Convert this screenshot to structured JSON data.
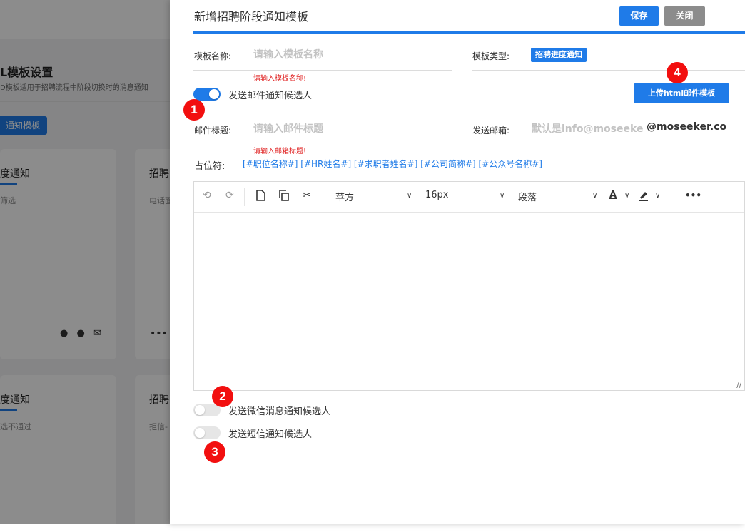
{
  "background": {
    "page_title": "L模板设置",
    "page_desc": "D模板适用于招聘流程中阶段切换时的消息通知",
    "add_button": "通知模板",
    "cards": [
      {
        "title": "度通知",
        "sub": "筛选"
      },
      {
        "title": "招聘",
        "sub": "电话面"
      },
      {
        "title": "度通知",
        "sub": "选不通过"
      },
      {
        "title": "招聘",
        "sub": "拒信-"
      }
    ],
    "card_icons": "● ● ✉",
    "more": "•••"
  },
  "drawer": {
    "title": "新增招聘阶段通知模板",
    "save_label": "保存",
    "close_label": "关闭",
    "template_name": {
      "label": "模板名称:",
      "placeholder": "请输入模板名称",
      "error": "请输入模板名称!"
    },
    "template_type": {
      "label": "模板类型:",
      "value": "招聘进度通知"
    },
    "email_toggle": {
      "label": "发送邮件通知候选人",
      "on": true
    },
    "upload_button": "上传html邮件模板",
    "email_title": {
      "label": "邮件标题:",
      "placeholder": "请输入邮件标题",
      "error": "请输入邮箱标题!"
    },
    "sender_email": {
      "label": "发送邮箱:",
      "placeholder": "默认是info@moseeker",
      "suffix": "@moseeker.co"
    },
    "placeholders": {
      "label": "占位符:",
      "text": "[#职位名称#] [#HR姓名#] [#求职者姓名#] [#公司简称#] [#公众号名称#]"
    },
    "editor": {
      "font": "苹方",
      "size": "16px",
      "paragraph": "段落",
      "font_color": "A",
      "more": "•••"
    },
    "wechat_toggle": {
      "label": "发送微信消息通知候选人",
      "on": false
    },
    "sms_toggle": {
      "label": "发送短信通知候选人",
      "on": false
    }
  },
  "annotations": [
    "1",
    "2",
    "3",
    "4"
  ],
  "colors": {
    "accent": "#1f7be8",
    "badge": "#f20f0f",
    "error": "#e02020"
  }
}
